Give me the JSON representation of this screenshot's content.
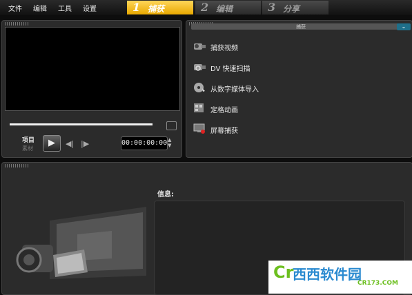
{
  "menu": {
    "file": "文件",
    "edit": "编辑",
    "tools": "工具",
    "settings": "设置"
  },
  "steps": [
    {
      "num": "1",
      "label": "捕获",
      "active": true
    },
    {
      "num": "2",
      "label": "编辑",
      "active": false
    },
    {
      "num": "3",
      "label": "分享",
      "active": false
    }
  ],
  "player": {
    "project_label": "项目",
    "clip_label": "素材",
    "timecode": "00:00:00:00"
  },
  "capture": {
    "header": "捕获",
    "items": [
      {
        "label": "捕获视频",
        "icon": "camcorder-icon"
      },
      {
        "label": "DV 快速扫描",
        "icon": "dv-scan-icon"
      },
      {
        "label": "从数字媒体导入",
        "icon": "disc-import-icon"
      },
      {
        "label": "定格动画",
        "icon": "stop-motion-icon"
      },
      {
        "label": "屏幕捕获",
        "icon": "screen-capture-icon"
      }
    ]
  },
  "info": {
    "label": "信息:"
  },
  "watermark": {
    "logo": "Cr",
    "name": "西西软件园",
    "site": "CR173.COM"
  },
  "colors": {
    "accent": "#f0b400",
    "background": "#0d0d0d",
    "panel": "#2b2b2b"
  }
}
